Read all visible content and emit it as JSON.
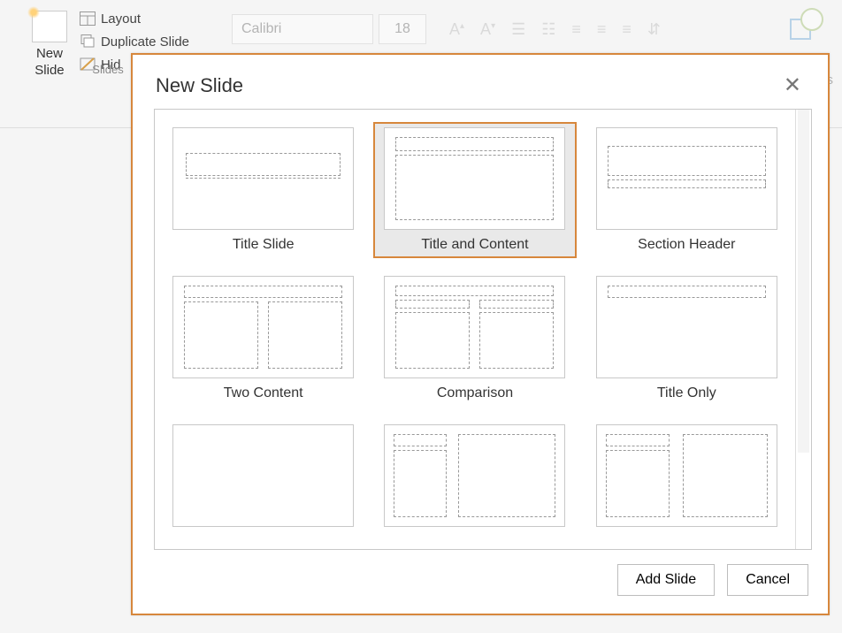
{
  "ribbon": {
    "new_slide_label": "New\nSlide",
    "layout_label": "Layout",
    "duplicate_label": "Duplicate Slide",
    "hide_label": "Hid",
    "slides_group_label": "Slides",
    "font_name": "Calibri",
    "font_size": "18",
    "right_truncated_label": "es"
  },
  "dialog": {
    "title": "New Slide",
    "add_label": "Add Slide",
    "cancel_label": "Cancel",
    "layouts": [
      {
        "id": "title-slide",
        "label": "Title Slide",
        "selected": false
      },
      {
        "id": "title-and-content",
        "label": "Title and Content",
        "selected": true
      },
      {
        "id": "section-header",
        "label": "Section Header",
        "selected": false
      },
      {
        "id": "two-content",
        "label": "Two Content",
        "selected": false
      },
      {
        "id": "comparison",
        "label": "Comparison",
        "selected": false
      },
      {
        "id": "title-only",
        "label": "Title Only",
        "selected": false
      },
      {
        "id": "blank",
        "label": "",
        "selected": false
      },
      {
        "id": "content-caption",
        "label": "",
        "selected": false
      },
      {
        "id": "picture-caption",
        "label": "",
        "selected": false
      }
    ]
  }
}
